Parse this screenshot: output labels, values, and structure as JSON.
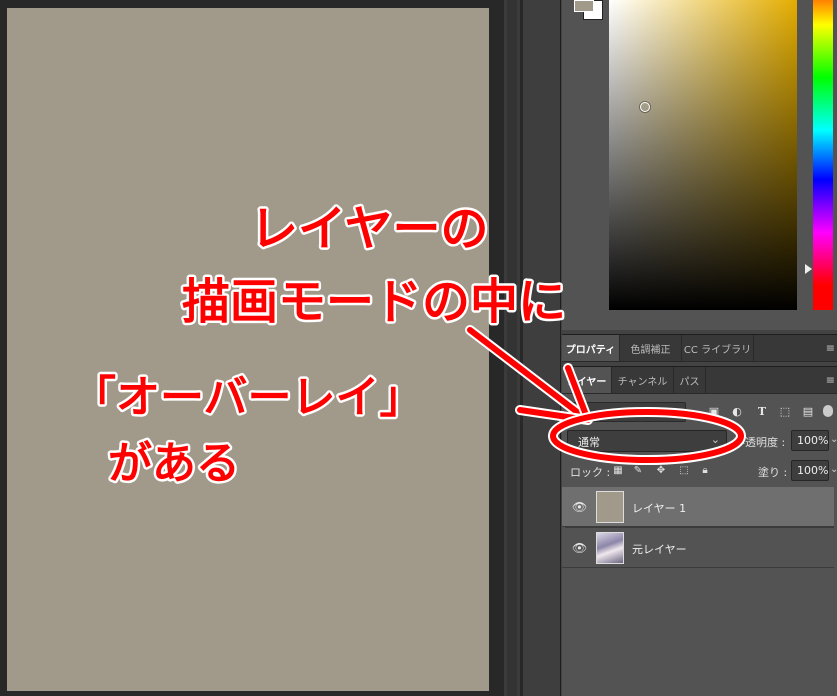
{
  "color_panel": {
    "foreground_color": "#a1998a",
    "background_color": "#ffffff",
    "field_hue_color": "#e3ad00"
  },
  "panel_tabs": {
    "top": [
      {
        "label": "プロパティ",
        "active": true
      },
      {
        "label": "色調補正",
        "active": false
      },
      {
        "label": "CC ライブラリ",
        "active": false
      }
    ],
    "layers": [
      {
        "label": "レイヤー",
        "active": true
      },
      {
        "label": "チャンネル",
        "active": false
      },
      {
        "label": "パス",
        "active": false
      }
    ],
    "menu_icon": "panel-menu-icon"
  },
  "layers_panel": {
    "blend_mode": "通常",
    "opacity_label": "不透明度 :",
    "opacity_value": "100%",
    "lock_label": "ロック :",
    "fill_label": "塗り :",
    "fill_value": "100%",
    "filter_icons": [
      "pixel-filter-icon",
      "adjustment-filter-icon",
      "type-filter-icon",
      "shape-filter-icon",
      "smart-object-filter-icon"
    ],
    "lock_icons": [
      "lock-transparent-icon",
      "lock-paint-icon",
      "lock-position-icon",
      "lock-artboard-icon",
      "lock-all-icon"
    ],
    "layers": [
      {
        "name": "レイヤー 1",
        "selected": true,
        "visible": true,
        "thumb_color": "#a1998a"
      },
      {
        "name": "元レイヤー",
        "selected": false,
        "visible": true,
        "thumb_color": "#c9c2d6"
      }
    ]
  },
  "document": {
    "canvas_color": "#a1998a"
  },
  "annotation": {
    "line1": "レイヤーの",
    "line2": "描画モードの中に",
    "line3": "「オーバーレイ」",
    "line4": "がある",
    "color": "#ff0000"
  }
}
